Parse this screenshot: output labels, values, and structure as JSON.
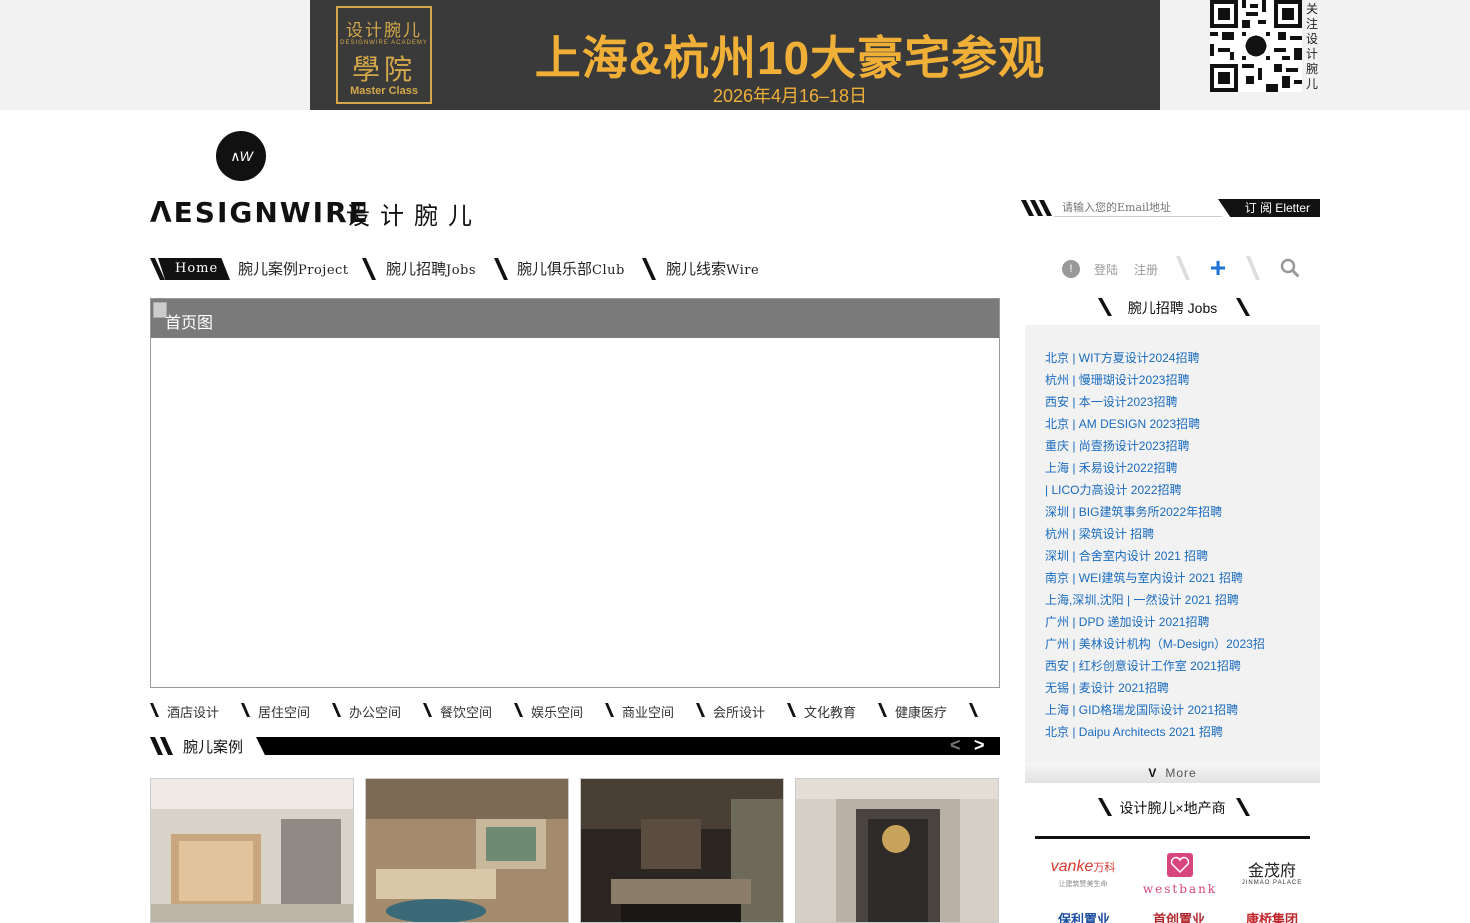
{
  "banner": {
    "logo_line1": "设计腕儿",
    "logo_line2": "DESIGNWIRE ACADEMY",
    "logo_line3": "學院",
    "logo_line4": "Master Class",
    "title": "上海&杭州10大豪宅参观",
    "date": "2026年4月16–18日"
  },
  "qr": {
    "caption": "关注设计腕儿"
  },
  "logo": {
    "mark": "∧W",
    "word": "ΛESIGNWIRE",
    "cn": "设计腕儿"
  },
  "subscribe": {
    "placeholder": "请输入您的Email地址",
    "button": "订 阅 Eletter"
  },
  "nav": {
    "home": "Home",
    "items": [
      {
        "cn": "腕儿案例",
        "en": "Project"
      },
      {
        "cn": "腕儿招聘",
        "en": "Jobs"
      },
      {
        "cn": "腕儿俱乐部",
        "en": "Club"
      },
      {
        "cn": "腕儿线索",
        "en": "Wire"
      }
    ]
  },
  "user": {
    "login": "登陆",
    "register": "注册",
    "icon": "user-icon",
    "add_icon": "plus-icon",
    "search_icon": "search-icon",
    "plus_color": "#1e73d8"
  },
  "slider": {
    "caption": "首页图"
  },
  "categories": [
    "酒店设计",
    "居住空间",
    "办公空间",
    "餐饮空间",
    "娱乐空间",
    "商业空间",
    "会所设计",
    "文化教育",
    "健康医疗"
  ],
  "projects_section": {
    "title": "腕儿案例",
    "prev": "<",
    "next": ">"
  },
  "jobs_section": {
    "title": "腕儿招聘 Jobs",
    "items": [
      "北京 | WIT方夏设计2024招聘",
      "杭州 | 慢珊瑚设计2023招聘",
      "西安 | 本一设计2023招聘",
      "北京 | AM DESIGN 2023招聘",
      "重庆 | 尚壹扬设计2023招聘",
      "上海 | 禾易设计2022招聘",
      "| LICO力高设计 2022招聘",
      "深圳 | BIG建筑事务所2022年招聘",
      "杭州 | 梁筑设计 招聘",
      "深圳 | 合舍室内设计 2021 招聘",
      "南京 | WEI建筑与室内设计 2021 招聘",
      "上海,深圳,沈阳 | 一然设计 2021 招聘",
      "广州 | DPD 递加设计 2021招聘",
      "广州 | 美林设计机构（M-Design）2023招",
      "西安 | 红杉创意设计工作室 2021招聘",
      "无锡 | 麦设计 2021招聘",
      "上海 | GID格瑞龙国际设计 2021招聘",
      "北京 | Daipu Architects 2021 招聘"
    ],
    "more": "More"
  },
  "developer_section": {
    "title": "设计腕儿×地产商",
    "logos": [
      {
        "name": "vanke",
        "main": "vanke",
        "sub": "万科",
        "tag": "让建筑赞美生命"
      },
      {
        "name": "westbank",
        "main": "westbank"
      },
      {
        "name": "jinmao",
        "main": "金茂府",
        "sub": "JINMAO PALACE"
      },
      {
        "name": "poly",
        "main": "保利置业"
      },
      {
        "name": "shoukai",
        "main": "首创置业"
      },
      {
        "name": "kangqiao",
        "main": "康桥集团"
      }
    ]
  }
}
